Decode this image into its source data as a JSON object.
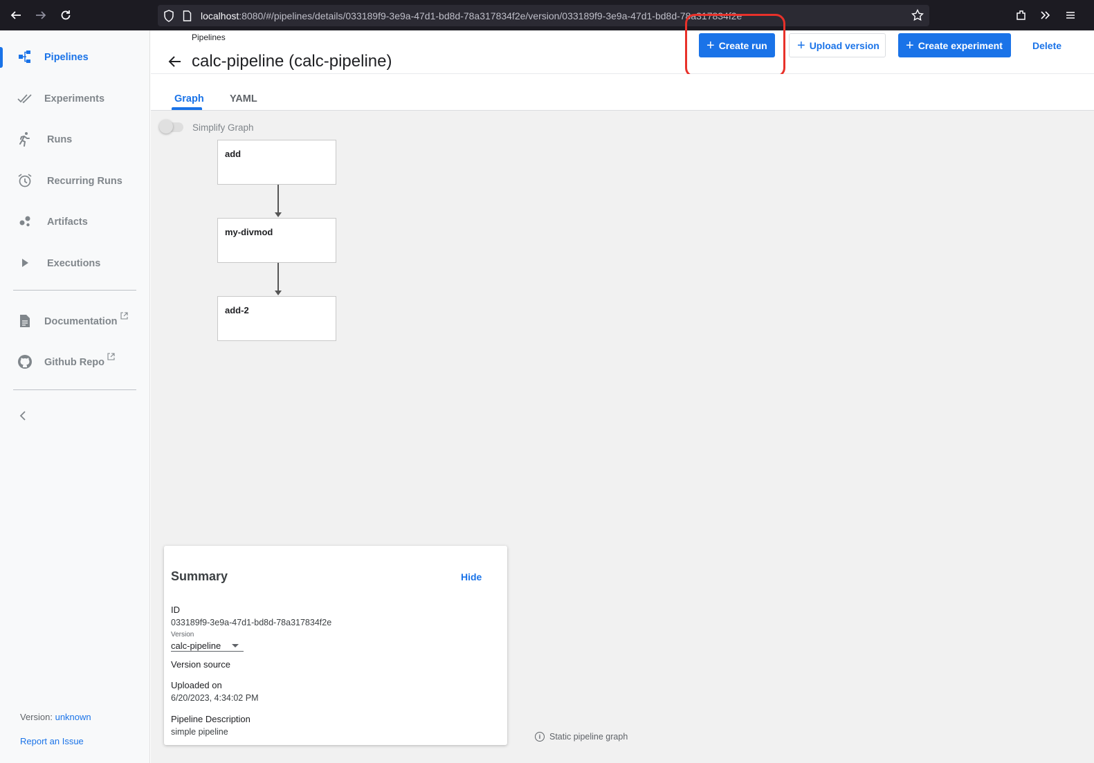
{
  "browser": {
    "url_host": "localhost",
    "url_rest": ":8080/#/pipelines/details/033189f9-3e9a-47d1-bd8d-78a317834f2e/version/033189f9-3e9a-47d1-bd8d-78a317834f2e"
  },
  "sidebar": {
    "items": [
      {
        "label": "Pipelines",
        "icon": "pipelines-icon",
        "active": true
      },
      {
        "label": "Experiments",
        "icon": "experiments-icon"
      },
      {
        "label": "Runs",
        "icon": "runs-icon"
      },
      {
        "label": "Recurring Runs",
        "icon": "alarm-clock-icon"
      },
      {
        "label": "Artifacts",
        "icon": "artifacts-icon"
      },
      {
        "label": "Executions",
        "icon": "play-icon"
      }
    ],
    "links": [
      {
        "label": "Documentation",
        "icon": "document-icon"
      },
      {
        "label": "Github Repo",
        "icon": "github-icon"
      }
    ],
    "version_label": "Version: ",
    "version_value": "unknown",
    "report_issue": "Report an Issue"
  },
  "header": {
    "breadcrumb": "Pipelines",
    "title": "calc-pipeline (calc-pipeline)",
    "buttons": {
      "create_run": "Create run",
      "upload_version": "Upload version",
      "create_experiment": "Create experiment",
      "delete": "Delete"
    }
  },
  "tabs": [
    "Graph",
    "YAML"
  ],
  "graph": {
    "simplify_label": "Simplify Graph",
    "nodes": [
      "add",
      "my-divmod",
      "add-2"
    ],
    "static_note": "Static pipeline graph"
  },
  "summary": {
    "title": "Summary",
    "hide": "Hide",
    "id_label": "ID",
    "id_value": "033189f9-3e9a-47d1-bd8d-78a317834f2e",
    "version_label": "Version",
    "version_value": "calc-pipeline",
    "version_source_label": "Version source",
    "uploaded_label": "Uploaded on",
    "uploaded_value": "6/20/2023, 4:34:02 PM",
    "description_label": "Pipeline Description",
    "description_value": "simple pipeline"
  },
  "colors": {
    "accent": "#1a73e8",
    "highlight": "#e8312a"
  }
}
